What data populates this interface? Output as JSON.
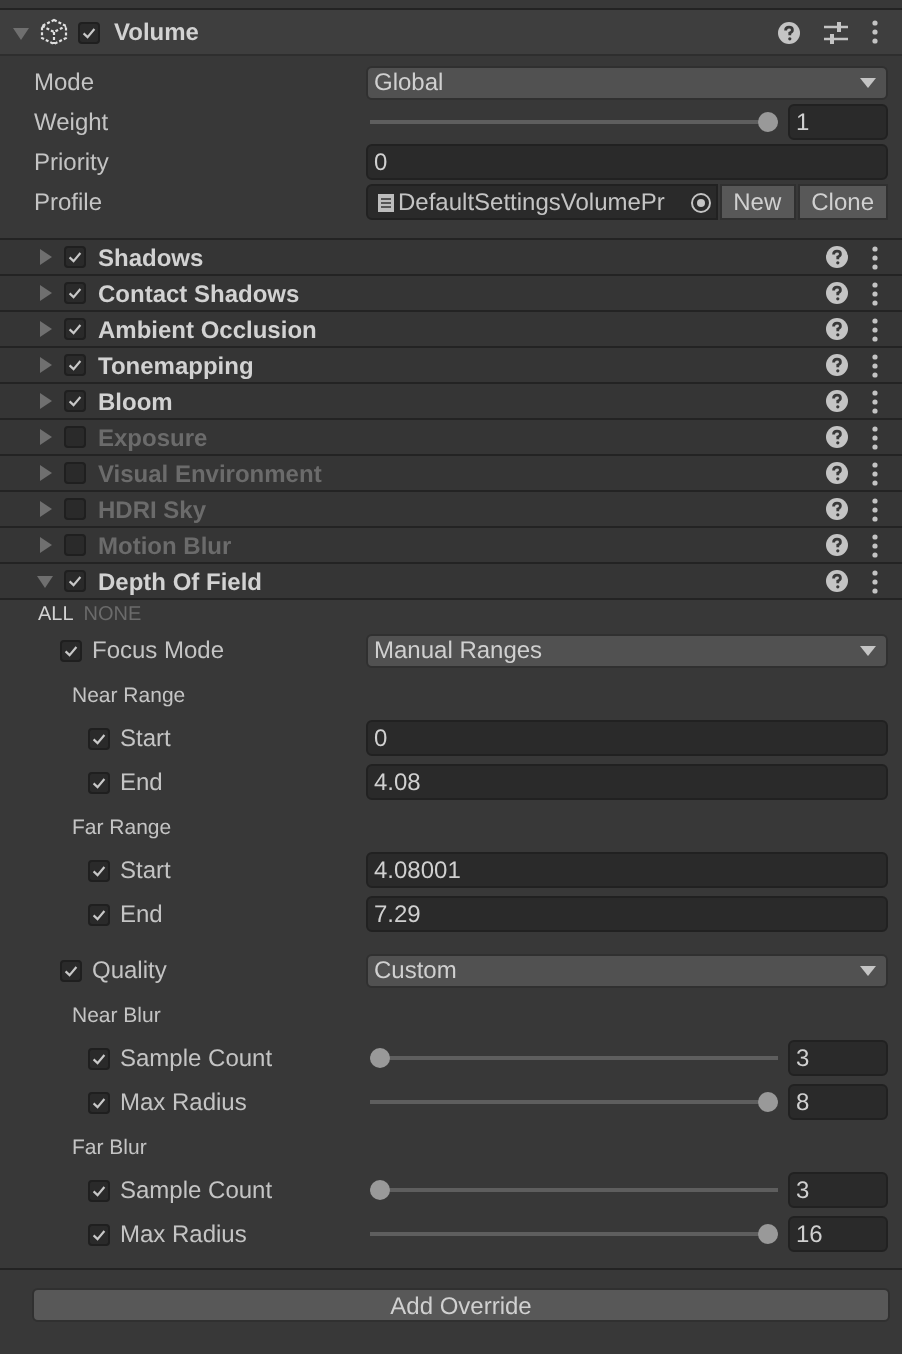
{
  "component": {
    "title": "Volume",
    "enabled": true,
    "expanded": true
  },
  "properties": [
    {
      "kind": "dropdown",
      "label": "Mode",
      "value": "Global"
    },
    {
      "kind": "slider",
      "label": "Weight",
      "level": 1,
      "value": "1"
    },
    {
      "kind": "number",
      "label": "Priority",
      "value": "0"
    },
    {
      "kind": "object",
      "label": "Profile",
      "value": "DefaultSettingsVolumePr",
      "buttons": [
        "New",
        "Clone"
      ]
    }
  ],
  "overrides": [
    {
      "title": "Shadows",
      "enabled": true,
      "expanded": false
    },
    {
      "title": "Contact Shadows",
      "enabled": true,
      "expanded": false
    },
    {
      "title": "Ambient Occlusion",
      "enabled": true,
      "expanded": false
    },
    {
      "title": "Tonemapping",
      "enabled": true,
      "expanded": false
    },
    {
      "title": "Bloom",
      "enabled": true,
      "expanded": false
    },
    {
      "title": "Exposure",
      "enabled": false,
      "expanded": false
    },
    {
      "title": "Visual Environment",
      "enabled": false,
      "expanded": false
    },
    {
      "title": "HDRI Sky",
      "enabled": false,
      "expanded": false
    },
    {
      "title": "Motion Blur",
      "enabled": false,
      "expanded": false
    },
    {
      "title": "Depth Of Field",
      "enabled": true,
      "expanded": true,
      "all_label": "ALL",
      "none_label": "NONE",
      "fields": [
        {
          "kind": "dropdown",
          "label": "Focus Mode",
          "overridden": true,
          "value": "Manual Ranges"
        },
        {
          "kind": "group",
          "label": "Near Range",
          "children": [
            {
              "kind": "number",
              "label": "Start",
              "overridden": true,
              "value": "0"
            },
            {
              "kind": "number",
              "label": "End",
              "overridden": true,
              "value": "4.08"
            }
          ]
        },
        {
          "kind": "group",
          "label": "Far Range",
          "children": [
            {
              "kind": "number",
              "label": "Start",
              "overridden": true,
              "value": "4.08001"
            },
            {
              "kind": "number",
              "label": "End",
              "overridden": true,
              "value": "7.29"
            }
          ]
        },
        {
          "kind": "dropdown",
          "label": "Quality",
          "overridden": true,
          "value": "Custom"
        },
        {
          "kind": "group",
          "label": "Near Blur",
          "children": [
            {
              "kind": "slider",
              "label": "Sample Count",
              "overridden": true,
              "level": 0,
              "value": "3"
            },
            {
              "kind": "slider",
              "label": "Max Radius",
              "overridden": true,
              "level": 1,
              "value": "8"
            }
          ]
        },
        {
          "kind": "group",
          "label": "Far Blur",
          "children": [
            {
              "kind": "slider",
              "label": "Sample Count",
              "overridden": true,
              "level": 0,
              "value": "3"
            },
            {
              "kind": "slider",
              "label": "Max Radius",
              "overridden": true,
              "level": 1,
              "value": "16"
            }
          ]
        }
      ]
    }
  ],
  "add_button": "Add Override"
}
